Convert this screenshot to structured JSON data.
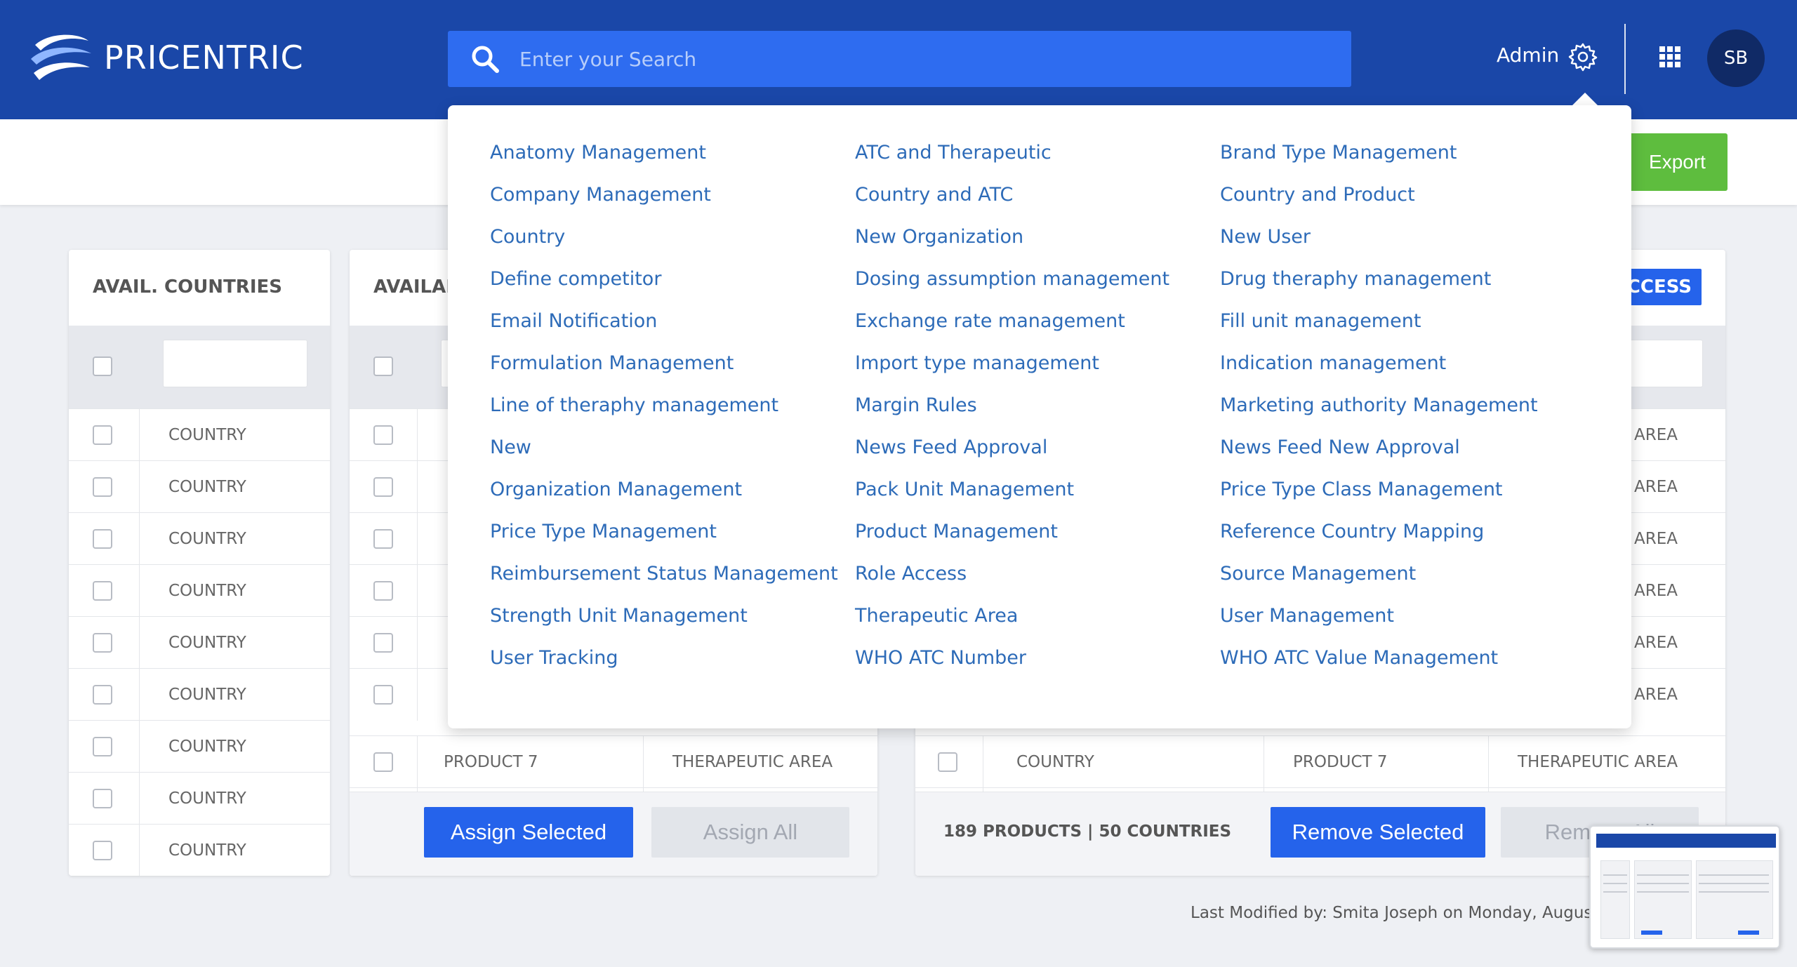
{
  "header": {
    "brand": "PRICENTRIC",
    "search_placeholder": "Enter your Search",
    "admin_label": "Admin",
    "avatar_initials": "SB"
  },
  "toolbar": {
    "export_label": "Export"
  },
  "panels": {
    "countries": {
      "title": "AVAIL. COUNTRIES",
      "rows": [
        "COUNTRY",
        "COUNTRY",
        "COUNTRY",
        "COUNTRY",
        "COUNTRY",
        "COUNTRY",
        "COUNTRY",
        "COUNTRY",
        "COUNTRY"
      ]
    },
    "products": {
      "title": "AVAILABLE PRODUCTS",
      "visible_row": {
        "product": "PRODUCT 7",
        "area": "THERAPEUTIC AREA"
      },
      "assign_selected": "Assign Selected",
      "assign_all": "Assign All"
    },
    "assigned": {
      "action_label": "ACCESS",
      "area_label": "AREA",
      "visible_row": {
        "country": "COUNTRY",
        "product": "PRODUCT 7",
        "area": "THERAPEUTIC AREA"
      },
      "stats": "189 PRODUCTS | 50 COUNTRIES",
      "remove_selected": "Remove Selected",
      "remove_all": "Remove All"
    }
  },
  "footer": {
    "last_modified": "Last Modified by: Smita Joseph on Monday, August"
  },
  "admin_menu": {
    "columns": [
      [
        "Anatomy Management",
        "Company Management",
        "Country",
        "Define competitor",
        "Email Notification",
        "Formulation Management",
        "Line of theraphy management",
        "New",
        "Organization Management",
        "Price Type Management",
        "Reimbursement Status Management",
        "Strength Unit Management",
        "User Tracking"
      ],
      [
        "ATC and Therapeutic",
        "Country and ATC",
        "New Organization",
        "Dosing assumption management",
        "Exchange rate management",
        "Import type management",
        "Margin Rules",
        "News Feed Approval",
        "Pack Unit Management",
        "Product Management",
        "Role Access",
        "Therapeutic Area",
        "WHO ATC Number"
      ],
      [
        "Brand Type Management",
        "Country and Product",
        "New User",
        "Drug theraphy management",
        "Fill unit management",
        "Indication management",
        "Marketing authority Management",
        "News Feed New Approval",
        "Price Type Class Management",
        "Reference Country Mapping",
        "Source Management",
        "User Management",
        "WHO ATC Value Management"
      ]
    ]
  },
  "colors": {
    "header_bg": "#1a47a8",
    "search_bg": "#2e6cf0",
    "link": "#2d6bb8",
    "primary_button": "#2563eb",
    "export_button": "#5ebd3e"
  }
}
